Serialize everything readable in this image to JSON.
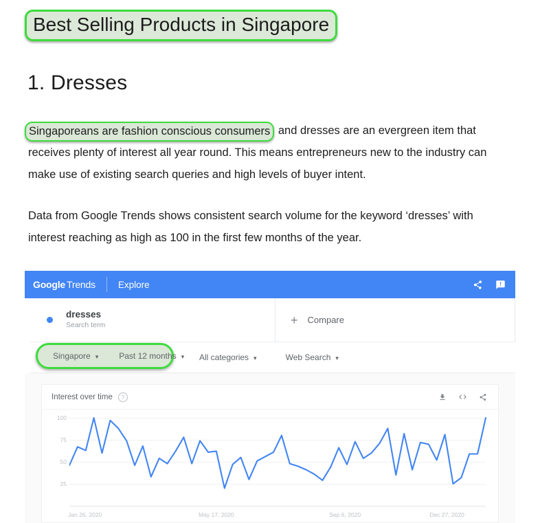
{
  "article": {
    "title": "Best Selling Products in Singapore",
    "heading": "1. Dresses",
    "paragraph1_highlight": "Singaporeans are fashion conscious consumers",
    "paragraph1_rest": " and dresses are an evergreen item that receives plenty of interest all year round. This means entrepreneurs new to the industry can make use of existing search queries and high levels of buyer intent.",
    "paragraph2": "Data from Google Trends shows consistent search volume for the keyword ‘dresses’ with interest reaching as high as 100 in the first few months of the year."
  },
  "trends": {
    "topbar": {
      "logo_bold": "Google",
      "logo_light": "Trends",
      "explore": "Explore",
      "share_icon": "share-icon",
      "feedback_icon": "feedback-icon"
    },
    "search": {
      "term": "dresses",
      "term_type": "Search term",
      "term_dot_color": "#4285f4",
      "compare_label": "Compare",
      "compare_icon": "plus-icon"
    },
    "filters": {
      "highlighted": [
        {
          "label": "Singapore",
          "caret": "▾"
        },
        {
          "label": "Past 12 months",
          "caret": "▾"
        }
      ],
      "rest": [
        {
          "label": "All categories",
          "caret": "▾"
        },
        {
          "label": "Web Search",
          "caret": "▾"
        }
      ],
      "highlight_color": "#3ddc3d"
    },
    "chart_card": {
      "title": "Interest over time",
      "help_icon": "help-icon",
      "help_glyph": "?",
      "actions": [
        {
          "name": "download-icon"
        },
        {
          "name": "embed-code-icon"
        },
        {
          "name": "share-icon"
        }
      ]
    }
  },
  "chart_data": {
    "type": "line",
    "title": "Interest over time",
    "xlabel": "",
    "ylabel": "",
    "ylim": [
      0,
      100
    ],
    "yticks": [
      25,
      50,
      75,
      100
    ],
    "grid": true,
    "legend": false,
    "line_color": "#4285f4",
    "xtick_labels": [
      "Jan 26, 2020",
      "May 17, 2020",
      "Sep 6, 2020",
      "Dec 27, 2020"
    ],
    "xtick_positions": [
      0,
      16,
      32,
      48
    ],
    "series": [
      {
        "name": "dresses",
        "values": [
          46,
          67,
          63,
          100,
          60,
          97,
          88,
          74,
          46,
          68,
          33,
          54,
          48,
          62,
          78,
          48,
          74,
          61,
          62,
          20,
          47,
          55,
          30,
          51,
          56,
          61,
          80,
          48,
          45,
          41,
          36,
          29,
          44,
          66,
          47,
          73,
          54,
          60,
          71,
          88,
          35,
          82,
          41,
          72,
          70,
          52,
          81,
          25,
          32,
          59,
          59,
          100
        ]
      }
    ]
  }
}
